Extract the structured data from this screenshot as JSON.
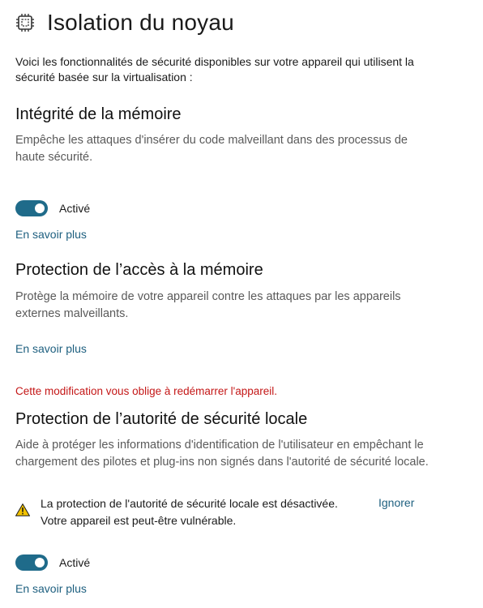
{
  "header": {
    "title": "Isolation du noyau",
    "icon": "chip-icon"
  },
  "intro": "Voici les fonctionnalités de sécurité disponibles sur votre appareil qui utilisent la sécurité basée sur la virtualisation :",
  "sections": [
    {
      "title": "Intégrité de la mémoire",
      "description": "Empêche les attaques d'insérer du code malveillant dans des processus de haute sécurité.",
      "toggle": {
        "state": "on",
        "label": "Activé"
      },
      "link": "En savoir plus"
    },
    {
      "title": "Protection de l’accès à la mémoire",
      "description": "Protège la mémoire de votre appareil contre les attaques par les appareils externes malveillants.",
      "link": "En savoir plus"
    },
    {
      "title": "Protection de l’autorité de sécurité locale",
      "description": "Aide à protéger les informations d'identification de l'utilisateur en empêchant le chargement des pilotes et plug-ins non signés dans l'autorité de sécurité locale.",
      "warning": {
        "line1": "La protection de l'autorité de sécurité locale est désactivée.",
        "line2": "Votre appareil est peut-être vulnérable.",
        "dismiss": "Ignorer",
        "icon": "warning-icon"
      },
      "toggle": {
        "state": "on",
        "label": "Activé"
      },
      "link": "En savoir plus"
    }
  ],
  "restart_notice": "Cette modification vous oblige à redémarrer l'appareil.",
  "colors": {
    "accent": "#1f6b8a",
    "link": "#1d5f7f",
    "error": "#c41717",
    "warning": "#f2c200"
  }
}
